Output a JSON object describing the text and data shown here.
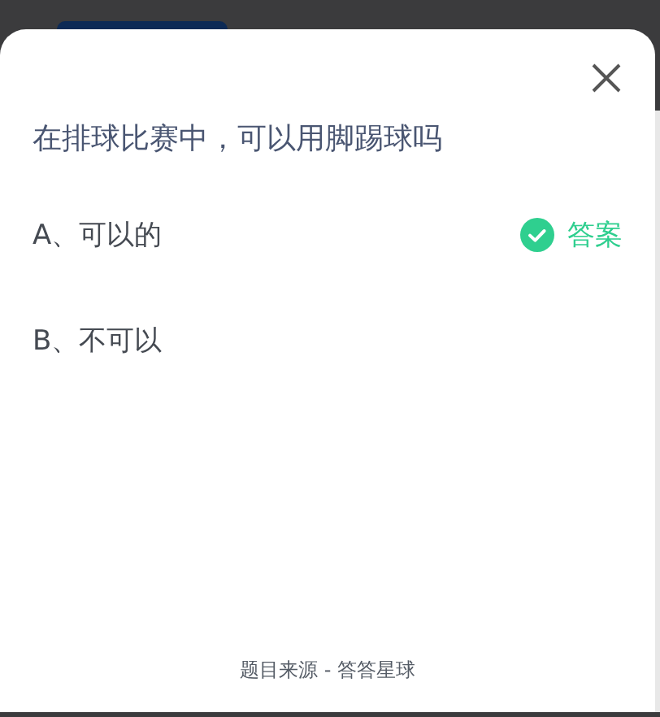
{
  "question": "在排球比赛中，可以用脚踢球吗",
  "options": [
    {
      "label": "A、可以的",
      "answer": true
    },
    {
      "label": "B、不可以",
      "answer": false
    }
  ],
  "answer_label": "答案",
  "footer": "题目来源 - 答答星球"
}
